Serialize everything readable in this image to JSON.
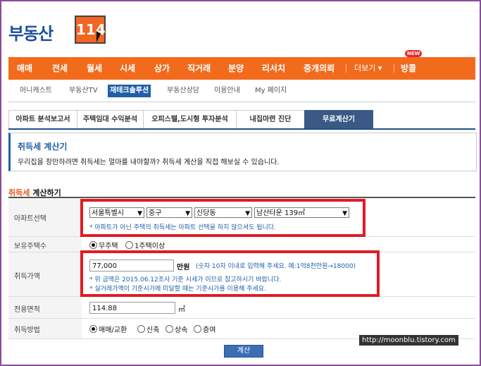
{
  "logo": {
    "text": "부동산",
    "number": "114"
  },
  "main_nav": {
    "items": [
      "매매",
      "전세",
      "월세",
      "시세",
      "상가",
      "직거래",
      "분양",
      "리서치",
      "중개의뢰",
      "더보기 ▾",
      "방콜"
    ],
    "new_badge": "NEW"
  },
  "sub_nav": {
    "items": [
      "머니캐스트",
      "부동산TV",
      "재테크솔루션",
      "부동산상담",
      "이용안내",
      "My 페이지"
    ],
    "active_index": 2
  },
  "tabs": {
    "items": [
      "아파트 분석보고서",
      "주택임대 수익분석",
      "오피스텔,도시형 투자분석",
      "내집마련 진단",
      "무료계산기"
    ],
    "active_index": 4
  },
  "info": {
    "title": "취득세 계산기",
    "desc": "우리집을 장만하려면 취득세는 얼마를 내야할까? 취득세 계산을 직접 해보실 수 있습니다."
  },
  "section": {
    "title_highlight": "취득세",
    "title_rest": " 계산하기"
  },
  "form": {
    "apartment": {
      "label": "아파트선택",
      "selects": [
        "서울특별시",
        "중구",
        "신당동",
        "남산타운 139㎡"
      ],
      "note": "* 아파트가 아닌 주택의 취득세는 아파트 선택을 하지 않으셔도 됩니다."
    },
    "houses_owned": {
      "label": "보유주택수",
      "options": [
        "무주택",
        "1주택이상"
      ],
      "selected_index": 0
    },
    "price": {
      "label": "취득가액",
      "value": "77,000",
      "unit": "만원",
      "hint": "(숫자 10자 이내로 입력해 주세요. 예:1억8천만원→18000)",
      "note1": "* 위 금액은 2015.06.12조사 기준 시세가 이므로 참고하시기 바랍니다.",
      "note2": "* 실거래가액이 기준시가에 미달할 때는 기준시가를 이용해 주세요."
    },
    "area": {
      "label": "전용면적",
      "value": "114.88",
      "unit": "㎡"
    },
    "method": {
      "label": "취득방법",
      "options": [
        "매매/교환",
        "신축",
        "상속",
        "증여"
      ],
      "selected_index": 0
    }
  },
  "buttons": {
    "calculate": "계산"
  },
  "watermark": "http://moonblu.tistory.com",
  "colors": {
    "brand_orange": "#f26b1d",
    "brand_blue": "#1f5fa8",
    "highlight_red": "#e01b24",
    "frame": "#8a4b9c"
  }
}
